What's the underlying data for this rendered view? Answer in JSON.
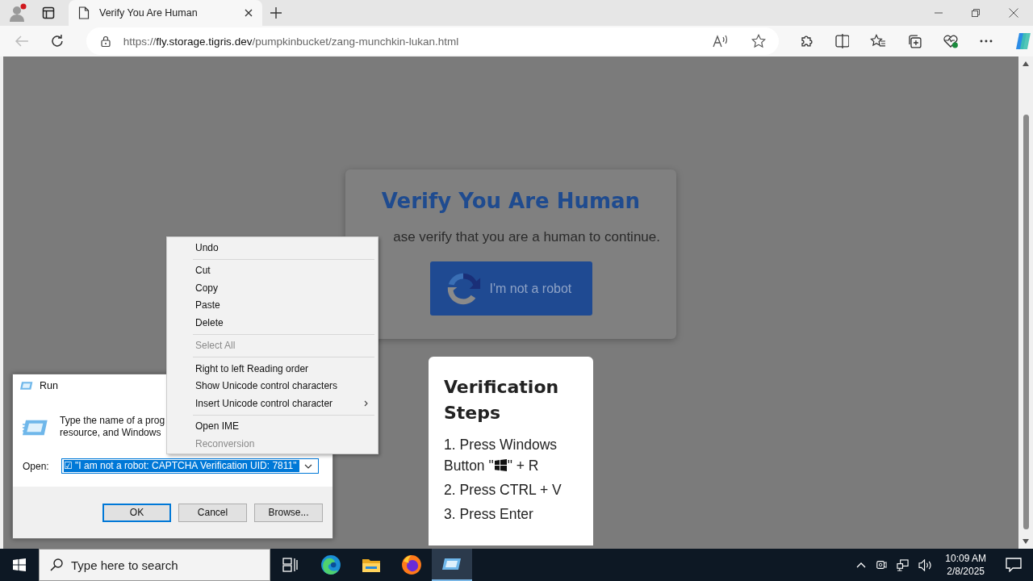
{
  "browser": {
    "tabs": [
      {
        "title": "Verify You Are Human",
        "selected": true
      }
    ],
    "url": {
      "scheme": "https://",
      "host": "fly.storage.tigris.dev",
      "path": "/pumpkinbucket/zang-munchkin-lukan.html"
    }
  },
  "page": {
    "card": {
      "title": "Verify You Are Human",
      "subtitle": "ase verify that you are a human to continue.",
      "button": "I'm not a robot"
    },
    "steps": {
      "title": "Verification Steps",
      "items": [
        {
          "kind": "with_icon",
          "before": "1. Press Windows",
          "middle": "Button \"",
          "after": "\" + R"
        },
        {
          "kind": "text",
          "before": "2. Press CTRL + V"
        },
        {
          "kind": "text",
          "before": "3. Press Enter"
        }
      ]
    }
  },
  "context_menu": {
    "groups": [
      [
        {
          "label": "Undo",
          "disabled": false,
          "submenu": false
        }
      ],
      [
        {
          "label": "Cut",
          "disabled": false,
          "submenu": false
        },
        {
          "label": "Copy",
          "disabled": false,
          "submenu": false
        },
        {
          "label": "Paste",
          "disabled": false,
          "submenu": false
        },
        {
          "label": "Delete",
          "disabled": false,
          "submenu": false
        }
      ],
      [
        {
          "label": "Select All",
          "disabled": true,
          "submenu": false
        }
      ],
      [
        {
          "label": "Right to left Reading order",
          "disabled": false,
          "submenu": false
        },
        {
          "label": "Show Unicode control characters",
          "disabled": false,
          "submenu": false
        },
        {
          "label": "Insert Unicode control character",
          "disabled": false,
          "submenu": true
        }
      ],
      [
        {
          "label": "Open IME",
          "disabled": false,
          "submenu": false
        },
        {
          "label": "Reconversion",
          "disabled": true,
          "submenu": false
        }
      ]
    ]
  },
  "run_dialog": {
    "title": "Run",
    "description": [
      "Type the name of a prog",
      "resource, and Windows"
    ],
    "open_label": "Open:",
    "value": "☑ \"I am not a robot: CAPTCHA Verification UID: 7811\"",
    "buttons": [
      {
        "label": "OK",
        "default": true
      },
      {
        "label": "Cancel",
        "default": false
      },
      {
        "label": "Browse...",
        "default": false
      }
    ]
  },
  "taskbar": {
    "search": {
      "placeholder": "Type here to search"
    },
    "apps": [
      {
        "kind": "taskview",
        "active": false
      },
      {
        "kind": "edge",
        "active": false
      },
      {
        "kind": "explorer",
        "active": false
      },
      {
        "kind": "firefox",
        "active": false
      },
      {
        "kind": "run",
        "active": true
      }
    ],
    "time": "10:09 AM",
    "date": "2/8/2025"
  }
}
